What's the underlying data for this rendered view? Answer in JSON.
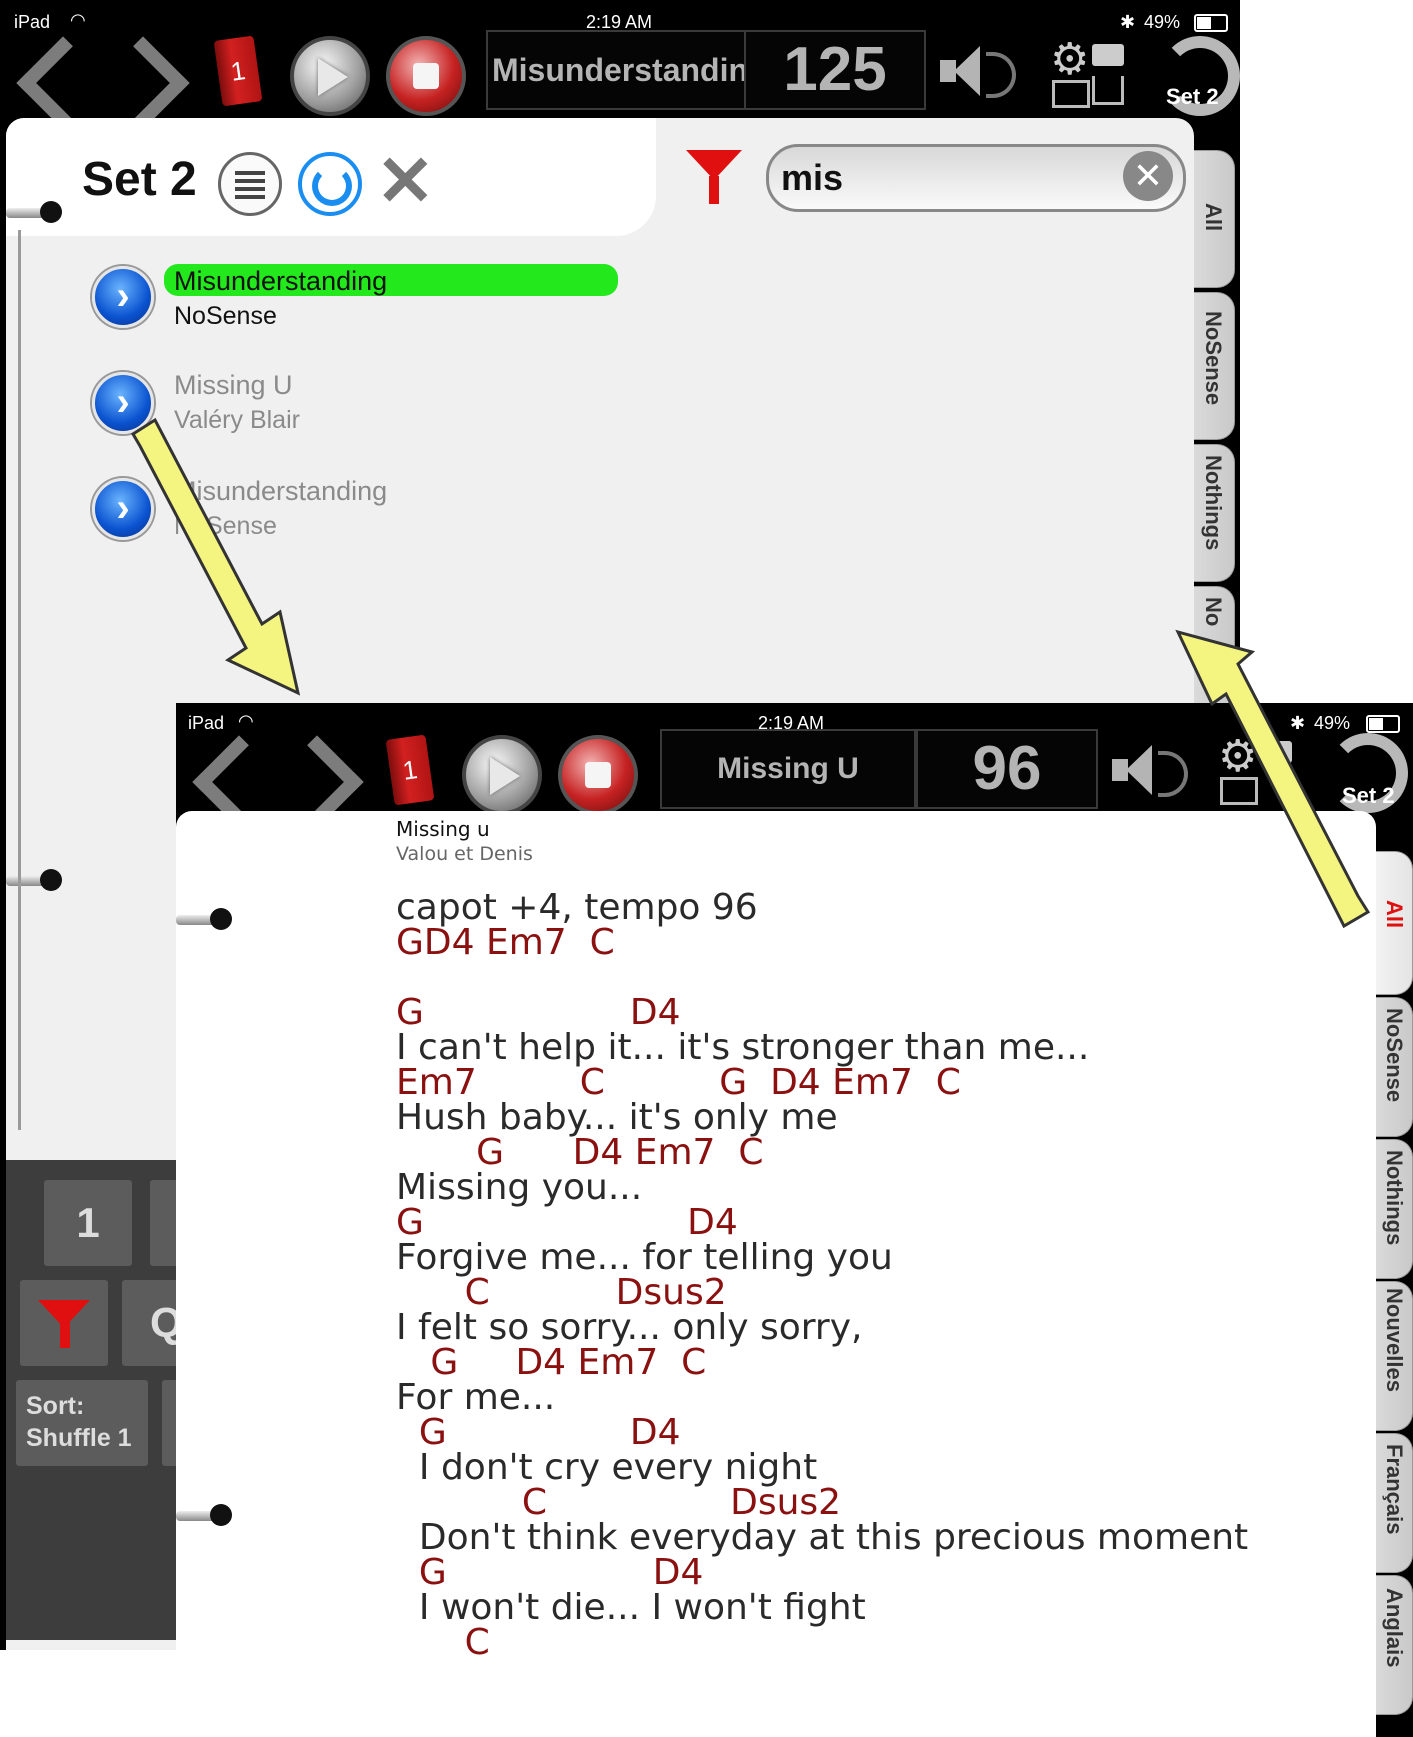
{
  "back": {
    "status": {
      "device": "iPad",
      "time": "2:19 AM",
      "battery": "49%"
    },
    "toolbar": {
      "book_number": "1",
      "lcd_title": "Misunderstandin",
      "lcd_tempo": "125",
      "set_label": "Set 2"
    },
    "header": {
      "set_title": "Set 2",
      "search_value": "mis"
    },
    "side_tabs": [
      "All",
      "NoSense",
      "Nothings",
      "No"
    ],
    "songs": [
      {
        "title": "Misunderstanding",
        "artist": "NoSense"
      },
      {
        "title": "Missing U",
        "artist": "Valéry Blair"
      },
      {
        "title": "Misunderstanding",
        "artist": "NoSense"
      }
    ],
    "keypad": {
      "key1": "1",
      "key_q": "Q",
      "sort_label": "Sort:",
      "sort_value": "Shuffle 1"
    }
  },
  "front": {
    "status": {
      "device": "iPad",
      "time": "2:19 AM",
      "battery": "49%"
    },
    "toolbar": {
      "book_number": "1",
      "lcd_title": "Missing U",
      "lcd_tempo": "96",
      "set_label": "Set 2"
    },
    "song": {
      "title": "Missing u",
      "artist": "Valou et Denis"
    },
    "side_tabs": [
      "All",
      "NoSense",
      "Nothings",
      "Nouvelles",
      "Français",
      "Anglais"
    ],
    "sheet": [
      {
        "type": "lyric",
        "text": "capot +4, tempo 96"
      },
      {
        "type": "chord",
        "text": "GD4 Em7  C"
      },
      {
        "type": "blank",
        "text": ""
      },
      {
        "type": "chord",
        "text": "G                  D4"
      },
      {
        "type": "lyric",
        "text": "I can't help it... it's stronger than me..."
      },
      {
        "type": "chord",
        "text": "Em7         C          G  D4 Em7  C"
      },
      {
        "type": "lyric",
        "text": "Hush baby... it's only me"
      },
      {
        "type": "chord",
        "text": "       G      D4 Em7  C"
      },
      {
        "type": "lyric",
        "text": "Missing you..."
      },
      {
        "type": "chord",
        "text": "G                       D4"
      },
      {
        "type": "lyric",
        "text": "Forgive me... for telling you"
      },
      {
        "type": "chord",
        "text": "      C           Dsus2"
      },
      {
        "type": "lyric",
        "text": "I felt so sorry... only sorry,"
      },
      {
        "type": "chord",
        "text": "   G     D4 Em7  C"
      },
      {
        "type": "lyric",
        "text": "For me..."
      },
      {
        "type": "chord",
        "text": "  G                D4"
      },
      {
        "type": "lyric",
        "text": "  I don't cry every night"
      },
      {
        "type": "chord",
        "text": "           C                Dsus2"
      },
      {
        "type": "lyric",
        "text": "  Don't think everyday at this precious moment"
      },
      {
        "type": "chord",
        "text": "  G                  D4"
      },
      {
        "type": "lyric",
        "text": "  I won't die... I won't fight"
      },
      {
        "type": "chord",
        "text": "      C"
      }
    ]
  },
  "colors": {
    "highlight": "#22e81c",
    "arrow": "#f4f480",
    "chord": "#8b1010",
    "active_tab": "#e01010"
  }
}
